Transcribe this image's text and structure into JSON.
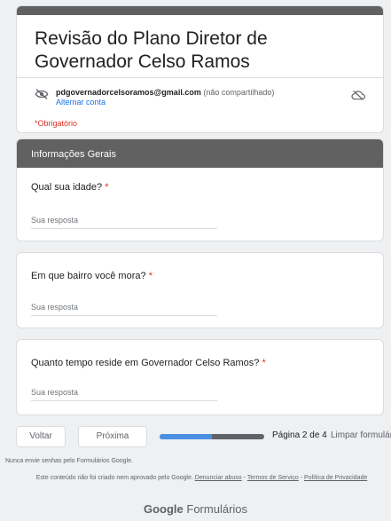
{
  "header": {
    "title": "Revisão do Plano Diretor de Governador Celso Ramos",
    "email": "pdgovernadorcelsoramos@gmail.com",
    "not_shared": "(não compartilhado)",
    "switch_account": "Alternar conta",
    "required_note": "*Obrigatório"
  },
  "section": {
    "title": "Informações Gerais"
  },
  "questions": [
    {
      "label": "Qual sua idade?",
      "required": "*",
      "placeholder": "Sua resposta"
    },
    {
      "label": "Em que bairro você mora?",
      "required": "*",
      "placeholder": "Sua resposta"
    },
    {
      "label": "Quanto tempo reside em Governador Celso Ramos?",
      "required": "*",
      "placeholder": "Sua resposta"
    }
  ],
  "navigation": {
    "back_label": "Voltar",
    "next_label": "Próxima",
    "page_text": "Página 2 de 4",
    "clear_label": "Limpar formulário",
    "progress_fraction": 0.5
  },
  "footer": {
    "warning": "Nunca envie senhas pelo Formulários Google.",
    "disclaimer_prefix": "Este conteúdo não foi criado nem aprovado pelo Google.",
    "report_abuse": "Denunciar abuso",
    "terms": "Termos de Serviço",
    "privacy": "Política de Privacidade",
    "brand_google": "Google",
    "brand_forms": "Formulários"
  },
  "colors": {
    "accent": "#616161",
    "required": "#d93025",
    "link": "#1a73e8",
    "progress_fill": "#4a90e2"
  },
  "icons": {
    "account": "eye-off-icon",
    "cloud": "cloud-off-icon"
  }
}
